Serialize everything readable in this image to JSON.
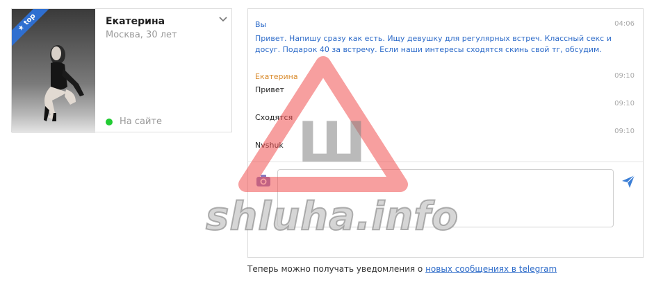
{
  "profile": {
    "name": "Екатерина",
    "location_age": "Москва, 30 лет",
    "status": "На сайте",
    "badge": "top",
    "status_color": "#22cc33",
    "badge_color": "#2f6fd0"
  },
  "chat": {
    "messages": [
      {
        "author": "Вы",
        "time": "04:06",
        "text": "Привет. Напишу сразу как есть. Ищу девушку для регулярных встреч. Классный секс и досуг. Подарок 40 за встречу. Если наши интересы сходятся скинь свой тг, обсудим."
      },
      {
        "author": "Екатерина",
        "time": "09:10",
        "text": "Привет"
      },
      {
        "time": "09:10",
        "text": "Сходятся"
      },
      {
        "time": "09:10",
        "text": "Nvshuk"
      }
    ],
    "composer_placeholder": "",
    "accent_color": "#2d6bc9",
    "author_color": "#d98a2b"
  },
  "notice": {
    "text": "Теперь можно получать уведомления о ",
    "link_text": "новых сообщениях в telegram"
  },
  "watermark": {
    "letter": "Ш",
    "site": "shluha.info"
  },
  "icons": {
    "chevron": "chevron-down-icon",
    "camera": "camera-icon",
    "send": "send-icon",
    "star": "star-icon"
  }
}
